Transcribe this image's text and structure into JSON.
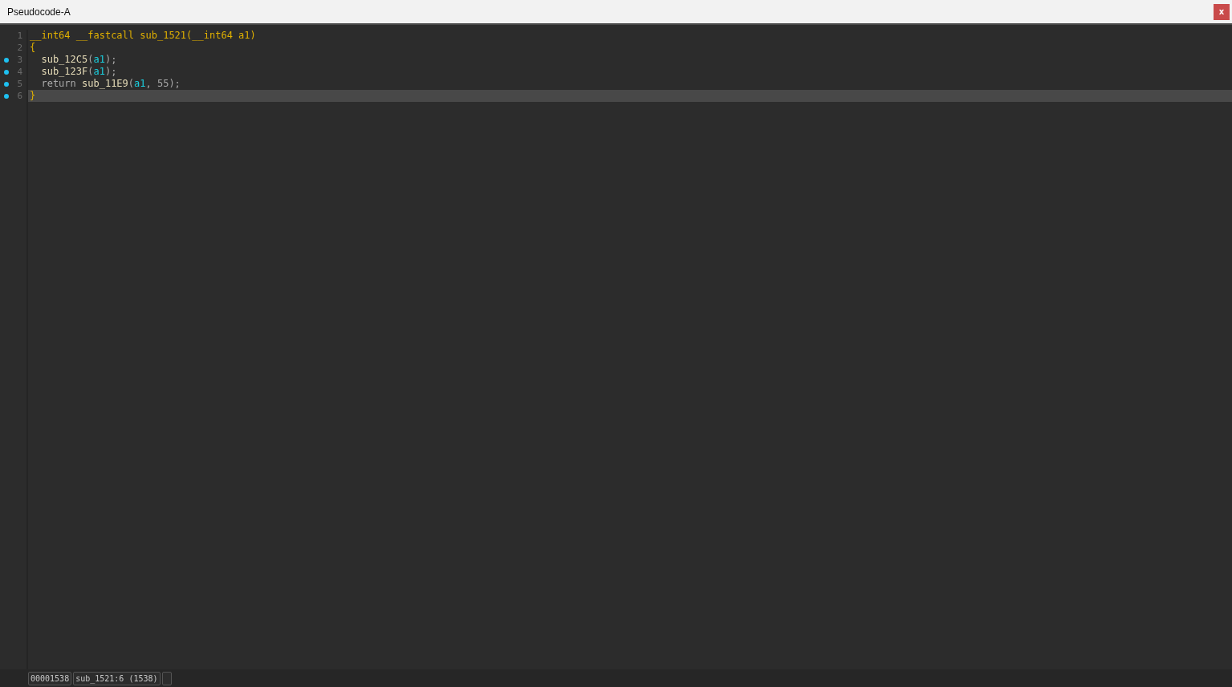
{
  "window": {
    "title": "Pseudocode-A",
    "close": "x"
  },
  "code": [
    {
      "number": "1",
      "breakpoint": false,
      "selected": false,
      "indented": false,
      "tokens": [
        {
          "kind": "decl",
          "text": "__int64 __fastcall sub_1521(__int64 a1)"
        }
      ]
    },
    {
      "number": "2",
      "breakpoint": false,
      "selected": false,
      "indented": false,
      "tokens": [
        {
          "kind": "decl",
          "text": "{"
        }
      ]
    },
    {
      "number": "3",
      "breakpoint": true,
      "selected": false,
      "indented": true,
      "tokens": [
        {
          "kind": "func",
          "text": "sub_12C5"
        },
        {
          "kind": "plain",
          "text": "("
        },
        {
          "kind": "var",
          "text": "a1"
        },
        {
          "kind": "plain",
          "text": ");"
        }
      ]
    },
    {
      "number": "4",
      "breakpoint": true,
      "selected": false,
      "indented": true,
      "tokens": [
        {
          "kind": "func",
          "text": "sub_123F"
        },
        {
          "kind": "plain",
          "text": "("
        },
        {
          "kind": "var",
          "text": "a1"
        },
        {
          "kind": "plain",
          "text": ");"
        }
      ]
    },
    {
      "number": "5",
      "breakpoint": true,
      "selected": false,
      "indented": true,
      "tokens": [
        {
          "kind": "keyword",
          "text": "return"
        },
        {
          "kind": "func",
          "text": "sub_11E9"
        },
        {
          "kind": "plain",
          "text": "("
        },
        {
          "kind": "var",
          "text": "a1"
        },
        {
          "kind": "plain",
          "text": ", 55);"
        }
      ]
    },
    {
      "number": "6",
      "breakpoint": true,
      "selected": true,
      "indented": false,
      "tokens": [
        {
          "kind": "decl",
          "text": "}"
        }
      ]
    }
  ],
  "status_bar": [
    "00001538",
    "sub_1521:6 (1538)"
  ]
}
